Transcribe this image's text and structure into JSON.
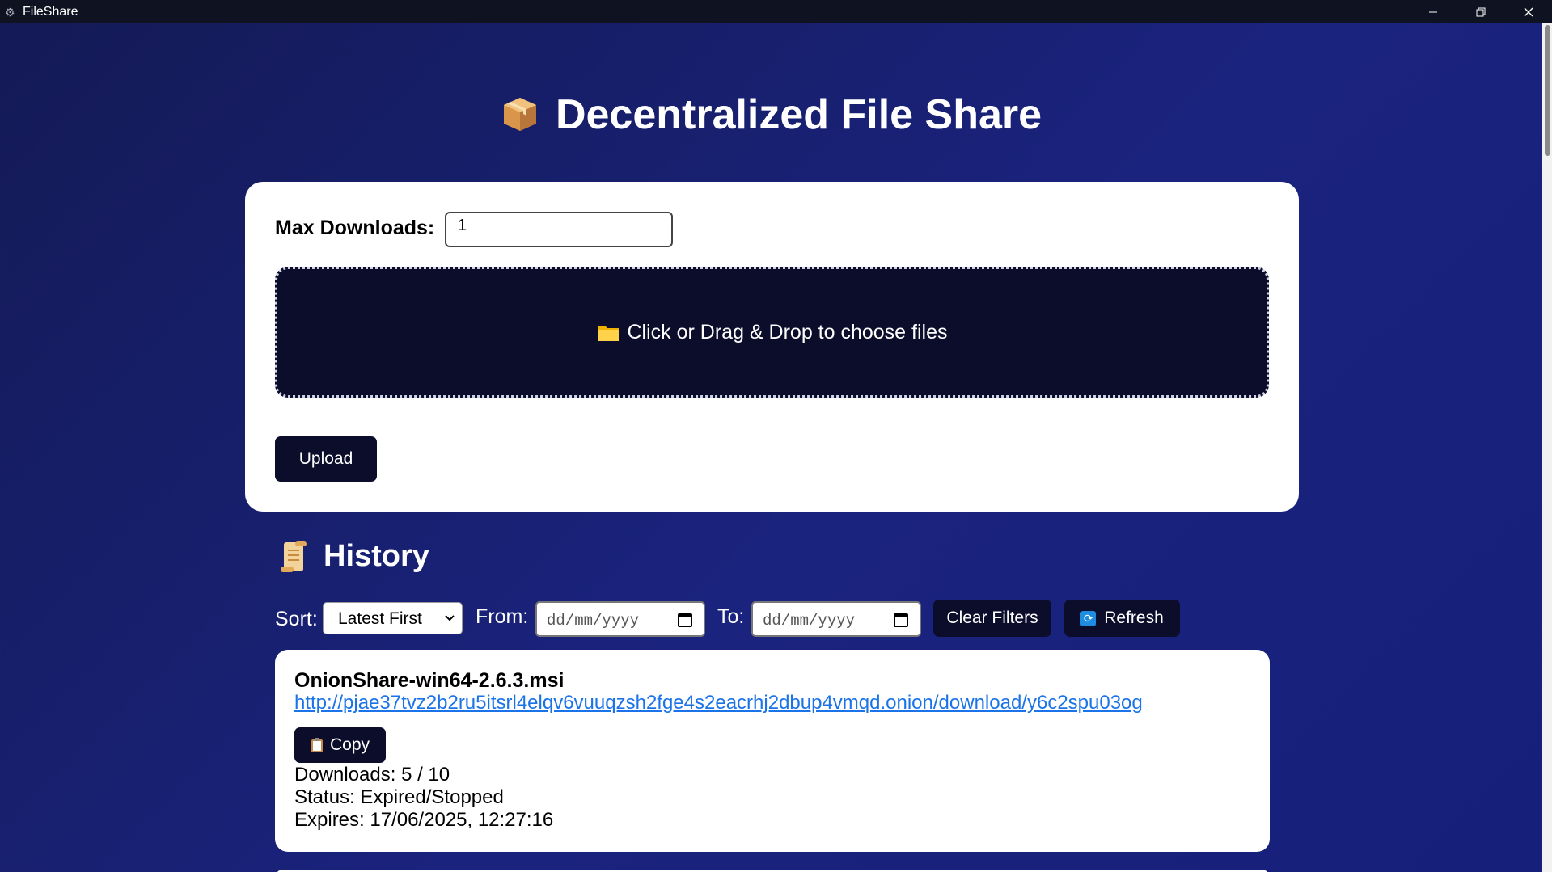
{
  "window": {
    "title": "FileShare"
  },
  "header": {
    "title": "Decentralized File Share",
    "icon": "package-icon"
  },
  "upload": {
    "max_downloads_label": "Max Downloads:",
    "max_downloads_value": "1",
    "dropzone_text": "Click or Drag & Drop to choose files",
    "dropzone_icon": "folder-icon",
    "upload_button": "Upload"
  },
  "history": {
    "title": "History",
    "icon": "scroll-icon",
    "sort_label": "Sort:",
    "sort_value": "Latest First",
    "from_label": "From:",
    "to_label": "To:",
    "date_placeholder": "dd/mm/yyyy",
    "clear_filters": "Clear Filters",
    "refresh": "Refresh",
    "items": [
      {
        "name": "OnionShare-win64-2.6.3.msi",
        "link": "http://pjae37tvz2b2ru5itsrl4elqv6vuuqzsh2fge4s2eacrhj2dbup4vmqd.onion/download/y6c2spu03og",
        "copy_label": "Copy",
        "downloads": "Downloads: 5 / 10",
        "status": "Status: Expired/Stopped",
        "expires": "Expires: 17/06/2025, 12:27:16"
      }
    ]
  },
  "colors": {
    "background": "#1a237e",
    "accent_dark": "#0c0d2b",
    "link": "#1a73e8"
  }
}
